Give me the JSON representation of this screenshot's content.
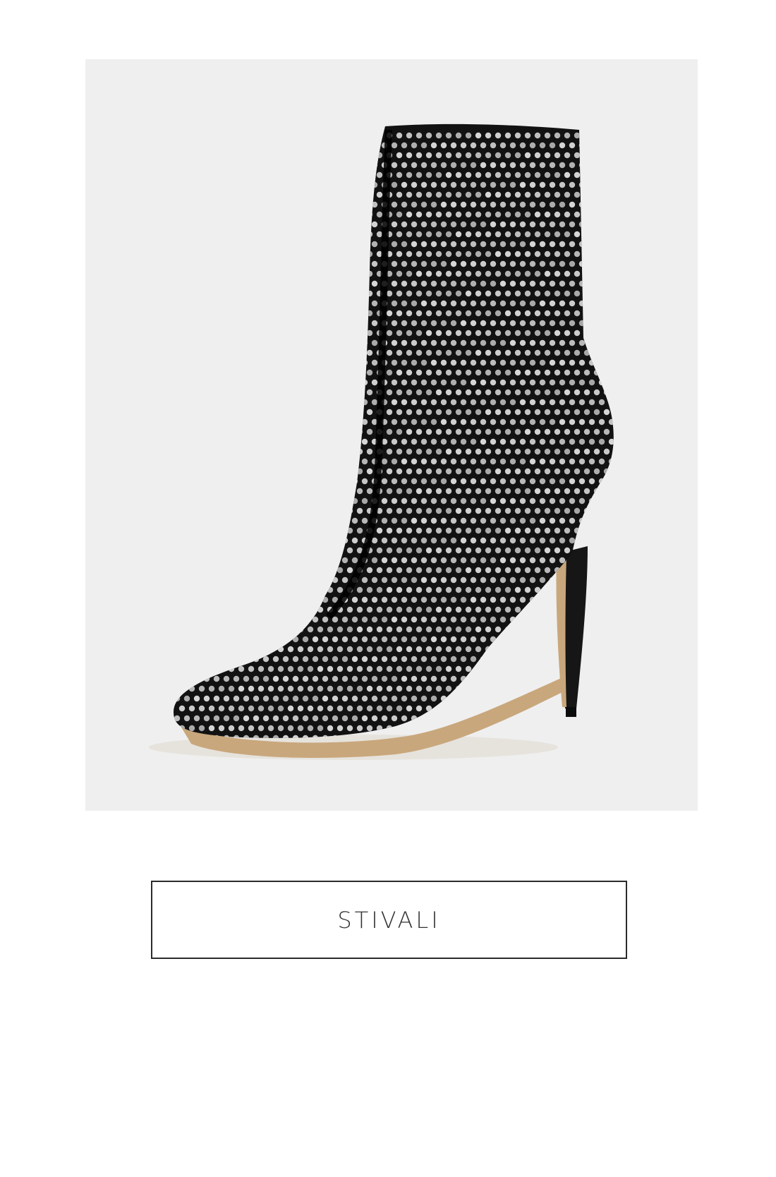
{
  "product": {
    "image_alt": "boot-with-rhinestones",
    "category_label": "STIVALI"
  },
  "colors": {
    "image_background": "#efefef",
    "boot": "#121212",
    "rhinestone": "#d9d9d9",
    "button_border": "#2b2b2b"
  }
}
